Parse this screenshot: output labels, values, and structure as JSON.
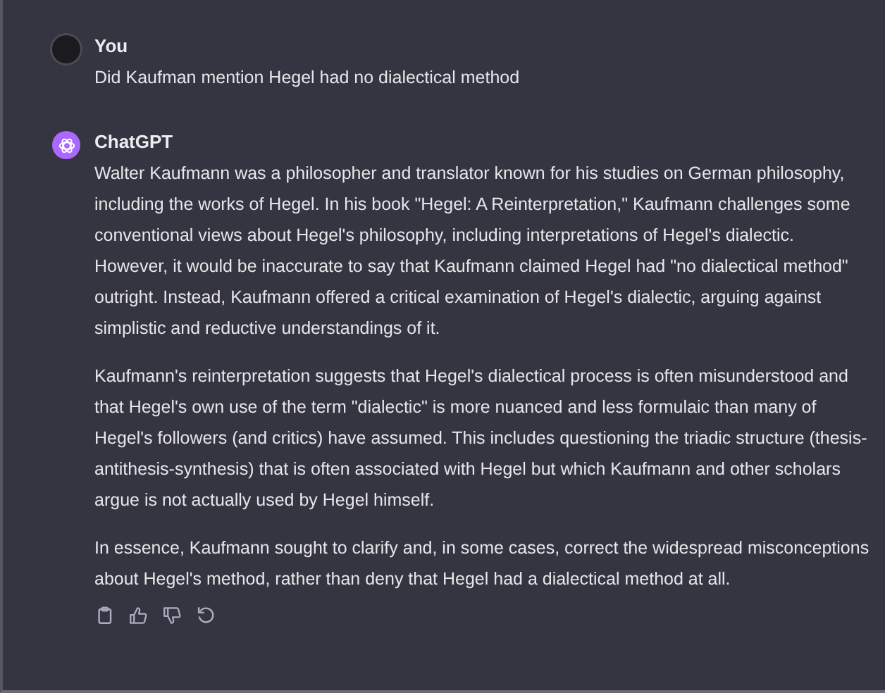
{
  "messages": [
    {
      "author": "You",
      "kind": "user",
      "paragraphs": [
        "Did Kaufman mention Hegel had no dialectical method"
      ]
    },
    {
      "author": "ChatGPT",
      "kind": "assistant",
      "paragraphs": [
        "Walter Kaufmann was a philosopher and translator known for his studies on German philosophy, including the works of Hegel. In his book \"Hegel: A Reinterpretation,\" Kaufmann challenges some conventional views about Hegel's philosophy, including interpretations of Hegel's dialectic. However, it would be inaccurate to say that Kaufmann claimed Hegel had \"no dialectical method\" outright. Instead, Kaufmann offered a critical examination of Hegel's dialectic, arguing against simplistic and reductive understandings of it.",
        "Kaufmann's reinterpretation suggests that Hegel's dialectical process is often misunderstood and that Hegel's own use of the term \"dialectic\" is more nuanced and less formulaic than many of Hegel's followers (and critics) have assumed. This includes questioning the triadic structure (thesis-antithesis-synthesis) that is often associated with Hegel but which Kaufmann and other scholars argue is not actually used by Hegel himself.",
        "In essence, Kaufmann sought to clarify and, in some cases, correct the widespread misconceptions about Hegel's method, rather than deny that Hegel had a dialectical method at all."
      ]
    }
  ]
}
